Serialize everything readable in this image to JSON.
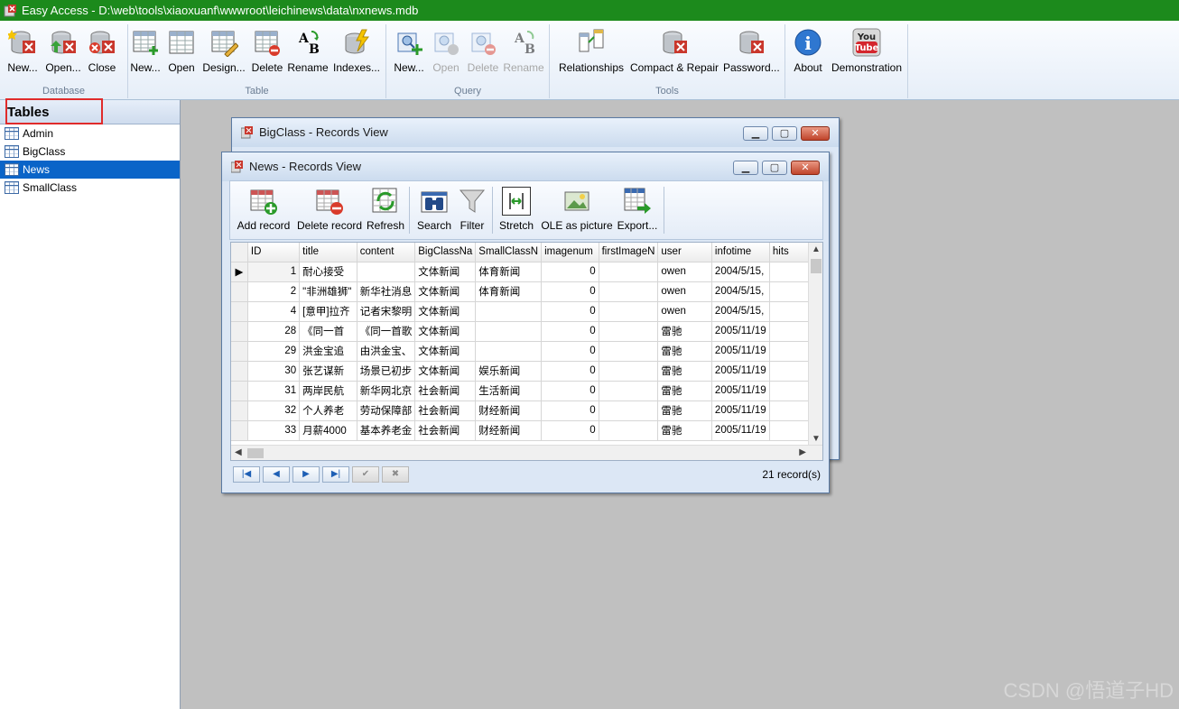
{
  "titlebar": {
    "title": "Easy Access - D:\\web\\tools\\xiaoxuanf\\wwwroot\\leichinews\\data\\nxnews.mdb"
  },
  "ribbon": {
    "groups": [
      {
        "label": "Database",
        "buttons": [
          "New...",
          "Open...",
          "Close"
        ]
      },
      {
        "label": "Table",
        "buttons": [
          "New...",
          "Open",
          "Design...",
          "Delete",
          "Rename",
          "Indexes..."
        ]
      },
      {
        "label": "Query",
        "buttons": [
          "New...",
          "Open",
          "Delete",
          "Rename"
        ],
        "disabled": [
          false,
          true,
          true,
          true
        ]
      },
      {
        "label": "Tools",
        "buttons": [
          "Relationships",
          "Compact & Repair",
          "Password..."
        ]
      },
      {
        "label": "",
        "buttons": [
          "About",
          "Demonstration"
        ]
      }
    ],
    "youtube_text": {
      "you": "You",
      "tube": "Tube"
    },
    "about_glyph": "i"
  },
  "leftpanel": {
    "header": "Tables",
    "items": [
      "Admin",
      "BigClass",
      "News",
      "SmallClass"
    ],
    "selected_index": 2
  },
  "bigclass_window": {
    "title": "BigClass - Records View"
  },
  "news_window": {
    "title": "News - Records View",
    "toolbar": [
      "Add record",
      "Delete record",
      "Refresh",
      "Search",
      "Filter",
      "Stretch",
      "OLE as picture",
      "Export..."
    ],
    "columns": [
      "ID",
      "title",
      "content",
      "BigClassNa",
      "SmallClassN",
      "imagenum",
      "firstImageN",
      "user",
      "infotime",
      "hits"
    ],
    "rows": [
      [
        "1",
        "耐心接受",
        "",
        "文体新闻",
        "体育新闻",
        "0",
        "",
        "owen",
        "2004/5/15,",
        ""
      ],
      [
        "2",
        "\"非洲雄狮\"",
        "新华社消息",
        "文体新闻",
        "体育新闻",
        "0",
        "",
        "owen",
        "2004/5/15,",
        ""
      ],
      [
        "4",
        "[意甲]拉齐",
        "记者宋黎明",
        "文体新闻",
        "",
        "0",
        "",
        "owen",
        "2004/5/15,",
        ""
      ],
      [
        "28",
        "《同一首",
        "《同一首歌",
        "文体新闻",
        "",
        "0",
        "",
        "雷驰",
        "2005/11/19",
        ""
      ],
      [
        "29",
        "洪金宝追",
        "由洪金宝、",
        "文体新闻",
        "",
        "0",
        "",
        "雷驰",
        "2005/11/19",
        ""
      ],
      [
        "30",
        "张艺谋新",
        "场景已初步",
        "文体新闻",
        "娱乐新闻",
        "0",
        "",
        "雷驰",
        "2005/11/19",
        ""
      ],
      [
        "31",
        "两岸民航",
        "新华网北京",
        "社会新闻",
        "生活新闻",
        "0",
        "",
        "雷驰",
        "2005/11/19",
        ""
      ],
      [
        "32",
        "个人养老",
        "劳动保障部",
        "社会新闻",
        "财经新闻",
        "0",
        "",
        "雷驰",
        "2005/11/19",
        ""
      ],
      [
        "33",
        "月薪4000",
        "基本养老金",
        "社会新闻",
        "财经新闻",
        "0",
        "",
        "雷驰",
        "2005/11/19",
        ""
      ]
    ],
    "current_row_index": 0,
    "nav": [
      "|◀",
      "◀",
      "▶",
      "▶|",
      "✔",
      "✖"
    ],
    "record_count": "21 record(s)"
  },
  "watermark": "CSDN @悟道子HD",
  "colors": {
    "titlebar": "#1c8a1c",
    "selection": "#0a64c8",
    "highlight_box": "#e02b2b",
    "mdi_background": "#c0c0c0"
  }
}
